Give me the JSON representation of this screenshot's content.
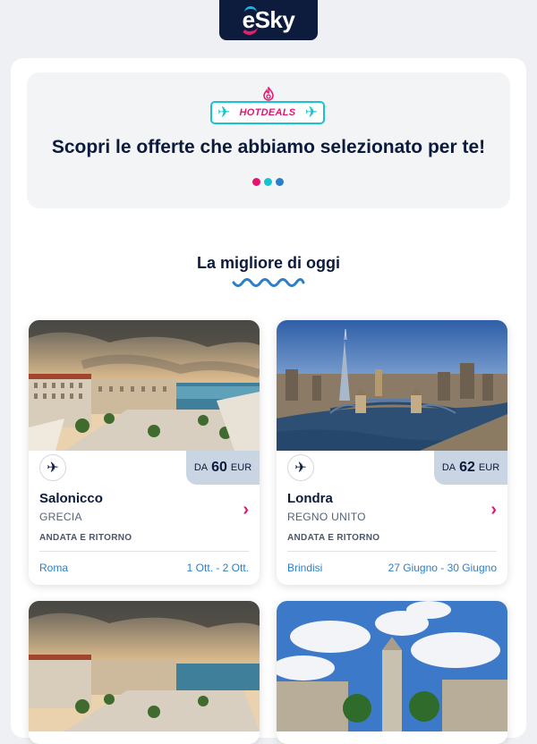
{
  "brand": {
    "logo_text": "eSky",
    "colors": {
      "navy": "#0d1b3d",
      "pink": "#e3166f",
      "cyan": "#12b5e6",
      "blue": "#2c7fc6"
    }
  },
  "hero": {
    "badge_label": "HOTDEALS",
    "badge_icons": [
      "airplane-icon",
      "flame-icon",
      "airplane-icon"
    ],
    "title": "Scopri le offerte che abbiamo selezionato per te!",
    "dot_colors": [
      "#e3166f",
      "#17c3d0",
      "#2c7fc6"
    ]
  },
  "section": {
    "title": "La migliore di oggi"
  },
  "deals": [
    {
      "price_prefix": "DA",
      "price": "60",
      "currency": "EUR",
      "city": "Salonicco",
      "country": "GRECIA",
      "trip_type": "ANDATA E RITORNO",
      "origin": "Roma",
      "dates": "1 Ott. - 2 Ott."
    },
    {
      "price_prefix": "DA",
      "price": "62",
      "currency": "EUR",
      "city": "Londra",
      "country": "REGNO UNITO",
      "trip_type": "ANDATA E RITORNO",
      "origin": "Brindisi",
      "dates": "27 Giugno - 30 Giugno"
    }
  ]
}
